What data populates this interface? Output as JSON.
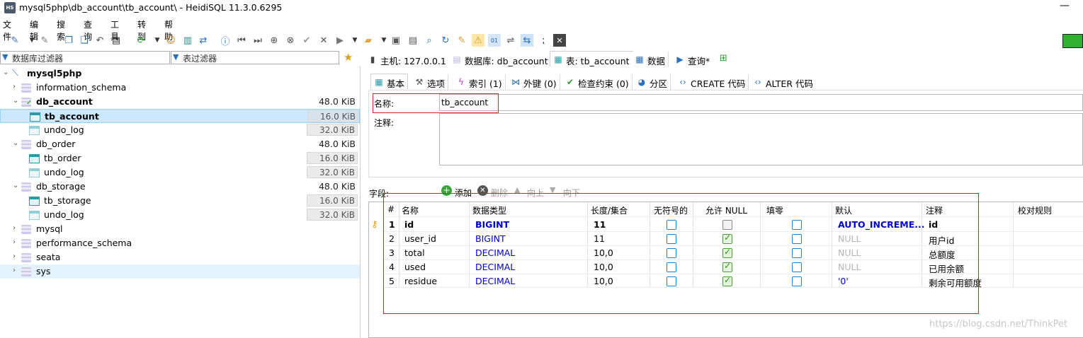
{
  "window": {
    "title": "mysql5php\\db_account\\tb_account\\ - HeidiSQL 11.3.0.6295",
    "app_icon": "HS",
    "minimize": "—"
  },
  "menu": [
    "文件",
    "编辑",
    "搜索",
    "查询",
    "工具",
    "转到",
    "帮助"
  ],
  "filters": {
    "db_placeholder": "数据库过滤器",
    "table_placeholder": "表过滤器"
  },
  "tree": {
    "root": "mysql5php",
    "items": [
      {
        "label": "information_schema"
      },
      {
        "label": "db_account",
        "size": "48.0 KiB"
      },
      {
        "label": "tb_account",
        "size": "16.0 KiB"
      },
      {
        "label": "undo_log",
        "size": "32.0 KiB"
      },
      {
        "label": "db_order",
        "size": "48.0 KiB"
      },
      {
        "label": "tb_order",
        "size": "16.0 KiB"
      },
      {
        "label": "undo_log",
        "size": "32.0 KiB"
      },
      {
        "label": "db_storage",
        "size": "48.0 KiB"
      },
      {
        "label": "tb_storage",
        "size": "16.0 KiB"
      },
      {
        "label": "undo_log",
        "size": "32.0 KiB"
      },
      {
        "label": "mysql"
      },
      {
        "label": "performance_schema"
      },
      {
        "label": "seata"
      },
      {
        "label": "sys"
      }
    ]
  },
  "main_tabs": [
    "主机: 127.0.0.1",
    "数据库: db_account",
    "表: tb_account",
    "数据",
    "查询*"
  ],
  "sub_tabs": [
    "基本",
    "选项",
    "索引 (1)",
    "外键 (0)",
    "检查约束 (0)",
    "分区",
    "CREATE 代码",
    "ALTER 代码"
  ],
  "form": {
    "name_label": "名称:",
    "name_value": "tb_account",
    "comment_label": "注释:"
  },
  "fields": {
    "label": "字段:",
    "add": "添加",
    "delete": "删除",
    "up": "向上",
    "down": "向下",
    "columns": [
      "#",
      "名称",
      "数据类型",
      "长度/集合",
      "无符号的",
      "允许 NULL",
      "填零",
      "默认",
      "注释",
      "校对规则"
    ],
    "rows": [
      {
        "num": "1",
        "name": "id",
        "type": "BIGINT",
        "length": "11",
        "unsigned": false,
        "allow_null": false,
        "zerofill": false,
        "default": "AUTO_INCREME...",
        "comment": "id"
      },
      {
        "num": "2",
        "name": "user_id",
        "type": "BIGINT",
        "length": "11",
        "unsigned": false,
        "allow_null": true,
        "zerofill": false,
        "default": "NULL",
        "comment": "用户id"
      },
      {
        "num": "3",
        "name": "total",
        "type": "DECIMAL",
        "length": "10,0",
        "unsigned": false,
        "allow_null": true,
        "zerofill": false,
        "default": "NULL",
        "comment": "总额度"
      },
      {
        "num": "4",
        "name": "used",
        "type": "DECIMAL",
        "length": "10,0",
        "unsigned": false,
        "allow_null": true,
        "zerofill": false,
        "default": "NULL",
        "comment": "已用余额"
      },
      {
        "num": "5",
        "name": "residue",
        "type": "DECIMAL",
        "length": "10,0",
        "unsigned": false,
        "allow_null": true,
        "zerofill": false,
        "default": "'0'",
        "comment": "剩余可用额度"
      }
    ]
  },
  "watermark": "https://blog.csdn.net/ThinkPet",
  "colors": {
    "accent_red": "#d1232e",
    "type_blue": "#0000cc",
    "status_green": "#2fb02f",
    "selection": "#cce8ff"
  }
}
